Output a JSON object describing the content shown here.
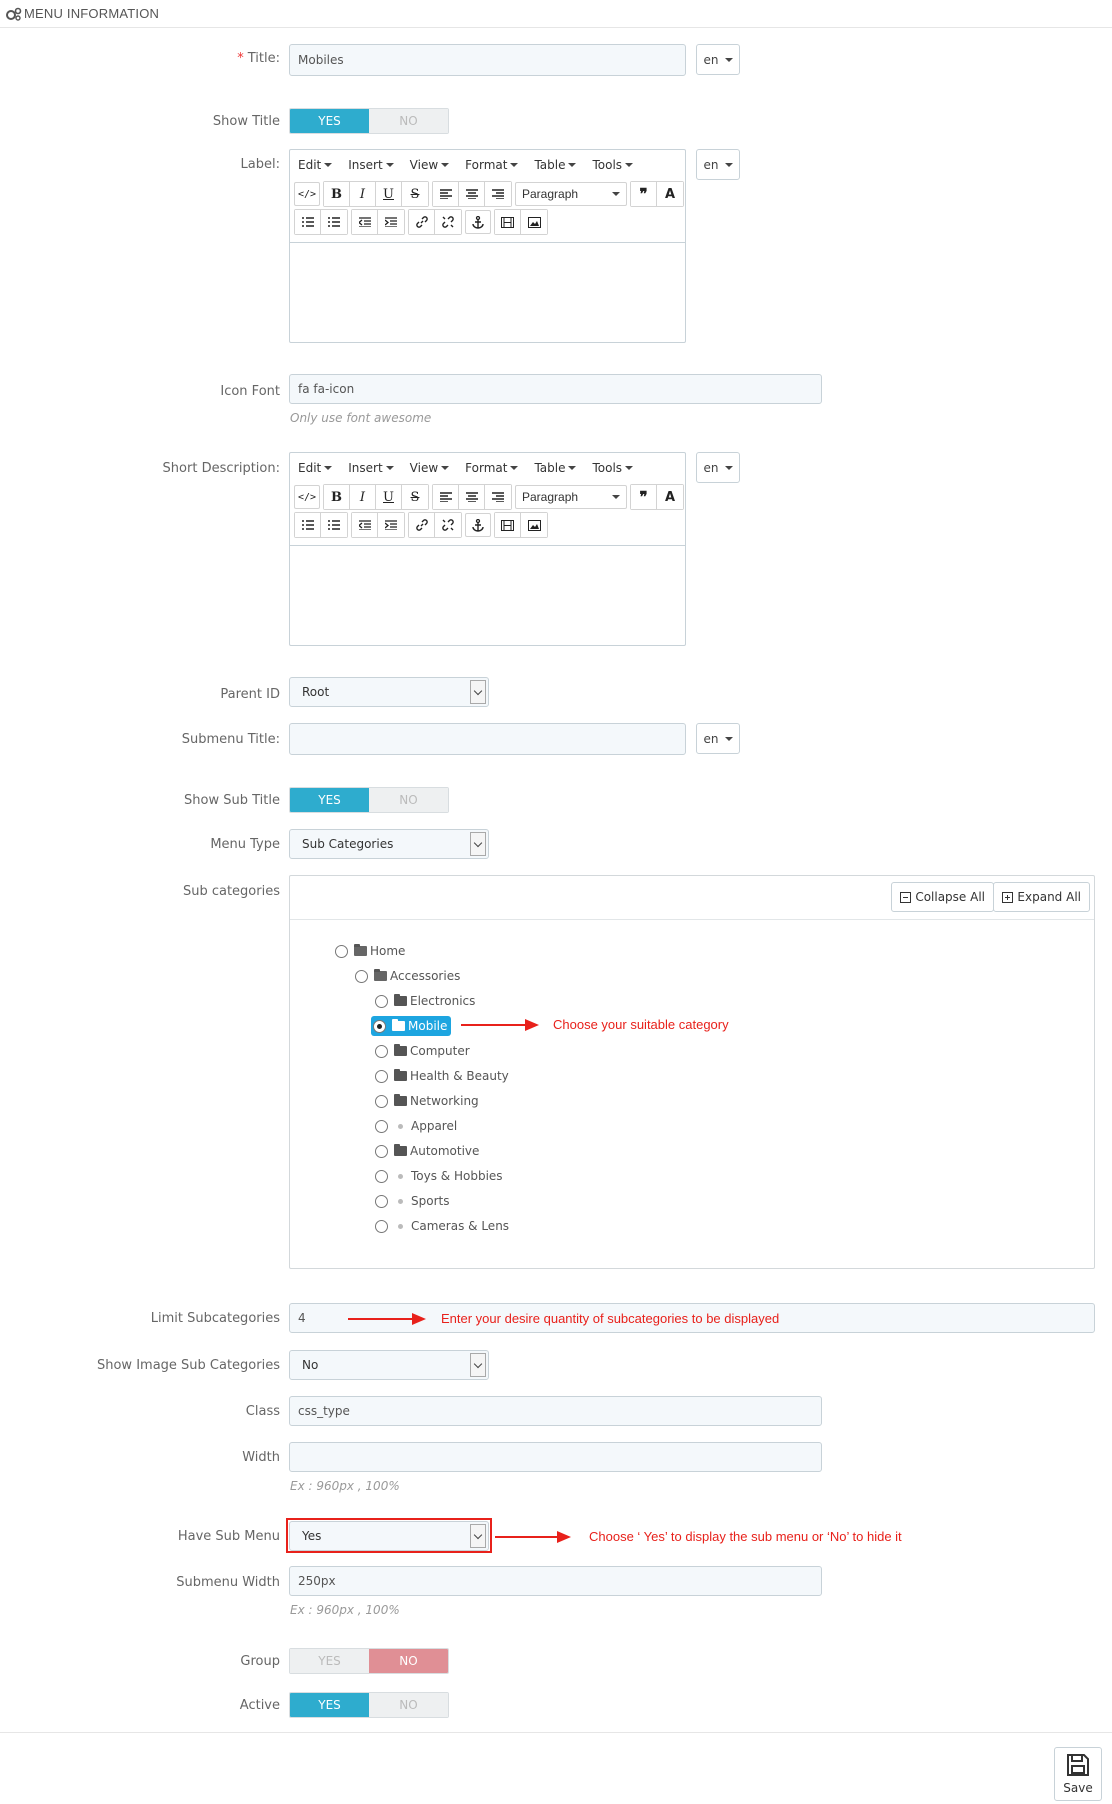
{
  "header": {
    "title": "MENU INFORMATION"
  },
  "lang": "en",
  "title_field": {
    "label": "Title:",
    "required_mark": "*",
    "value": "Mobiles"
  },
  "show_title": {
    "label": "Show Title",
    "yes": "YES",
    "no": "NO"
  },
  "label_field": {
    "label": "Label:"
  },
  "editor": {
    "menu": [
      "Edit",
      "Insert",
      "View",
      "Format",
      "Table",
      "Tools"
    ],
    "paragraph": "Paragraph",
    "code_label": "</>",
    "bold": "B",
    "italic": "I",
    "underline": "U",
    "strike": "S",
    "quote": "❞",
    "textcolor": "A"
  },
  "icon_font": {
    "label": "Icon Font",
    "value": "fa fa-icon",
    "help": "Only use font awesome"
  },
  "short_desc": {
    "label": "Short Description:"
  },
  "parent_id": {
    "label": "Parent ID",
    "value": "Root"
  },
  "submenu_title": {
    "label": "Submenu Title:",
    "value": ""
  },
  "show_sub_title": {
    "label": "Show Sub Title",
    "yes": "YES",
    "no": "NO"
  },
  "menu_type": {
    "label": "Menu Type",
    "value": "Sub Categories"
  },
  "sub_categories": {
    "label": "Sub categories",
    "collapse": "Collapse All",
    "expand": "Expand All",
    "tree": [
      {
        "name": "Home",
        "icon": "folder-open-icon"
      },
      {
        "name": "Accessories",
        "icon": "folder-open-icon"
      },
      {
        "name": "Electronics",
        "icon": "folder-icon"
      },
      {
        "name": "Mobile",
        "icon": "folder-icon",
        "selected": true
      },
      {
        "name": "Computer",
        "icon": "folder-icon"
      },
      {
        "name": "Health & Beauty",
        "icon": "folder-icon"
      },
      {
        "name": "Networking",
        "icon": "folder-icon"
      },
      {
        "name": "Apparel",
        "icon": "dot-icon"
      },
      {
        "name": "Automotive",
        "icon": "folder-icon"
      },
      {
        "name": "Toys & Hobbies",
        "icon": "dot-icon"
      },
      {
        "name": "Sports",
        "icon": "dot-icon"
      },
      {
        "name": "Cameras & Lens",
        "icon": "dot-icon"
      }
    ]
  },
  "limit_subcategories": {
    "label": "Limit Subcategories",
    "value": "4"
  },
  "show_image_sub": {
    "label": "Show Image Sub Categories",
    "value": "No"
  },
  "class_field": {
    "label": "Class",
    "value": "css_type"
  },
  "width_field": {
    "label": "Width",
    "value": "",
    "help": "Ex : 960px , 100%"
  },
  "have_sub_menu": {
    "label": "Have Sub Menu",
    "value": "Yes"
  },
  "submenu_width": {
    "label": "Submenu Width",
    "value": "250px",
    "help": "Ex : 960px , 100%"
  },
  "group": {
    "label": "Group",
    "yes": "YES",
    "no": "NO"
  },
  "active": {
    "label": "Active",
    "yes": "YES",
    "no": "NO"
  },
  "annotations": {
    "category": "Choose your suitable category",
    "limit": "Enter your desire quantity of subcategories to be displayed",
    "submenu": "Choose ‘ Yes’ to display the sub menu or ‘No’ to hide it"
  },
  "footer": {
    "save": "Save"
  },
  "colors": {
    "accent": "#2eacce",
    "no_active": "#e08f95",
    "annotation": "#e8211b",
    "selected_node": "#1da5e0"
  }
}
